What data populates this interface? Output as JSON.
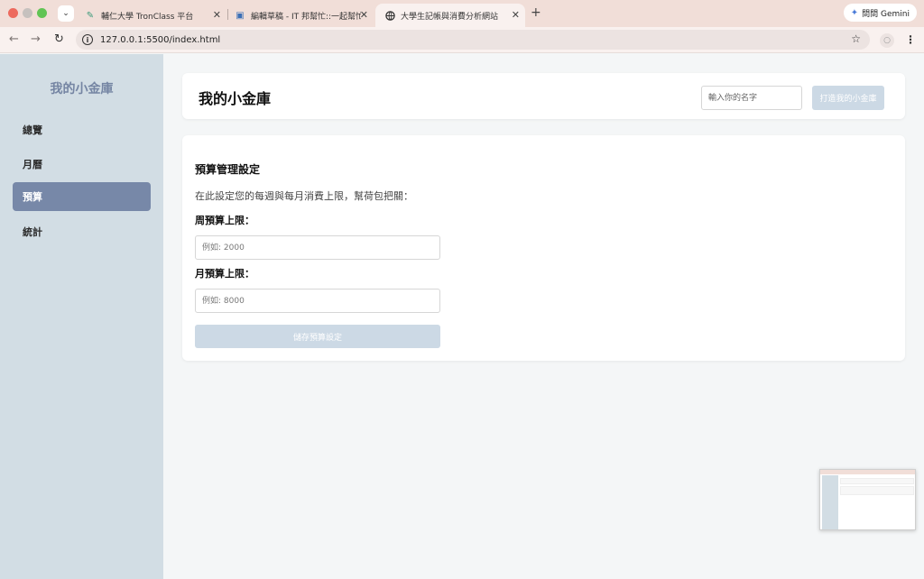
{
  "browser": {
    "tabs": [
      {
        "title": "輔仁大學 TronClass 平台",
        "icon": "tronclass-icon"
      },
      {
        "title": "編輯草稿 - IT 邦幫忙::一起幫忙解決難題",
        "icon": "ithome-icon"
      },
      {
        "title": "大學生記帳與消費分析網站",
        "icon": "globe-icon",
        "active": true
      }
    ],
    "gemini_label": "問問 Gemini",
    "url": "127.0.0.1:5500/index.html"
  },
  "sidebar": {
    "brand": "我的小金庫",
    "items": [
      {
        "label": "總覽"
      },
      {
        "label": "月曆"
      },
      {
        "label": "預算",
        "active": true
      },
      {
        "label": "統計"
      }
    ]
  },
  "header": {
    "title": "我的小金庫",
    "name_placeholder": "輸入你的名字",
    "build_button": "打造我的小金庫"
  },
  "budget": {
    "title": "預算管理設定",
    "description": "在此設定您的每週與每月消費上限，幫荷包把關：",
    "weekly_label": "周預算上限：",
    "weekly_placeholder": "例如: 2000",
    "monthly_label": "月預算上限：",
    "monthly_placeholder": "例如: 8000",
    "save_button": "儲存預算設定"
  },
  "colors": {
    "sidebar_bg": "#d2dde4",
    "active_nav": "#7788a8",
    "brand_text": "#7585a3",
    "disabled_button": "#ccd9e5"
  }
}
